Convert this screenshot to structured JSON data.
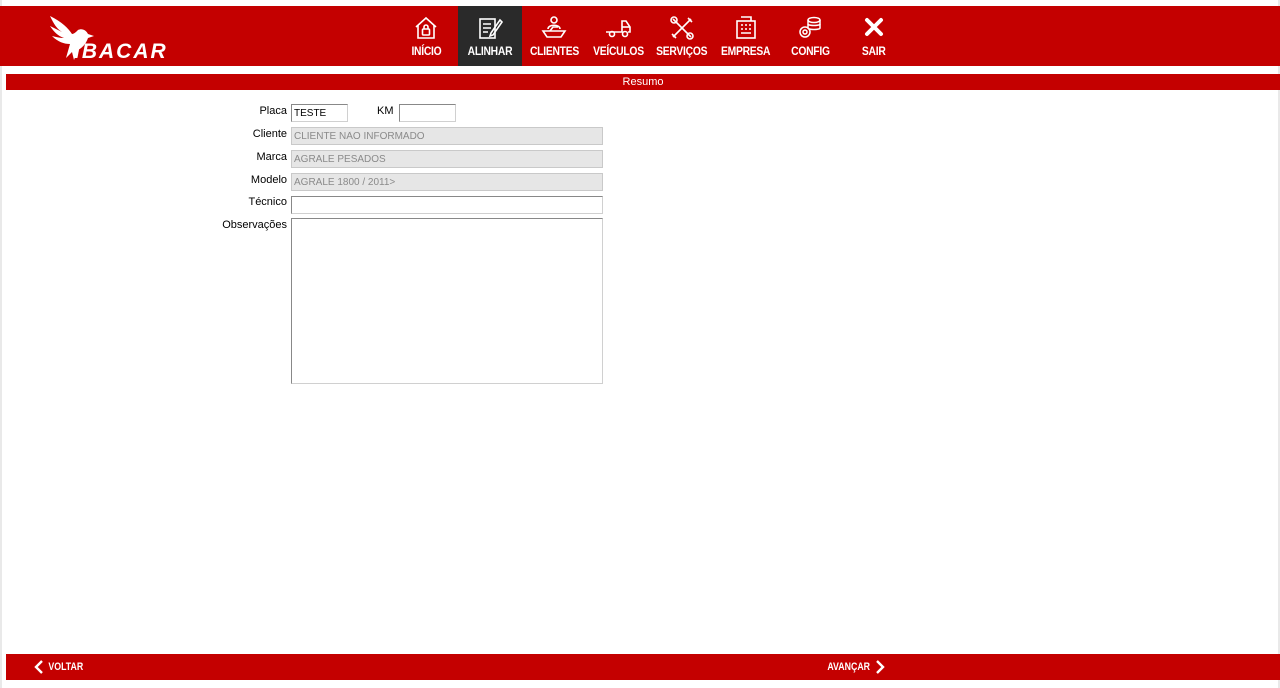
{
  "brand": {
    "name": "IBACAR",
    "color": "#c40000"
  },
  "nav": {
    "active": "alinhar",
    "items": [
      {
        "id": "inicio",
        "label": "INÍCIO",
        "icon": "home-lock-icon"
      },
      {
        "id": "alinhar",
        "label": "ALINHAR",
        "icon": "edit-document-icon"
      },
      {
        "id": "clientes",
        "label": "CLIENTES",
        "icon": "client-desk-icon"
      },
      {
        "id": "veiculos",
        "label": "VEÍCULOS",
        "icon": "truck-icon"
      },
      {
        "id": "servicos",
        "label": "SERVIÇOS",
        "icon": "tools-icon"
      },
      {
        "id": "empresa",
        "label": "EMPRESA",
        "icon": "building-icon"
      },
      {
        "id": "config",
        "label": "CONFIG",
        "icon": "gears-icon"
      },
      {
        "id": "sair",
        "label": "SAIR",
        "icon": "close-icon"
      }
    ]
  },
  "section": {
    "title": "Resumo"
  },
  "form": {
    "placa": {
      "label": "Placa",
      "value": "TESTE"
    },
    "km": {
      "label": "KM",
      "value": ""
    },
    "cliente": {
      "label": "Cliente",
      "value": "CLIENTE NÃO INFORMADO"
    },
    "marca": {
      "label": "Marca",
      "value": "AGRALE PESADOS"
    },
    "modelo": {
      "label": "Modelo",
      "value": "AGRALE 1800 / 2011>"
    },
    "tecnico": {
      "label": "Técnico",
      "value": ""
    },
    "observacoes": {
      "label": "Observações",
      "value": ""
    }
  },
  "footer": {
    "back_label": "VOLTAR",
    "next_label": "AVANÇAR"
  }
}
